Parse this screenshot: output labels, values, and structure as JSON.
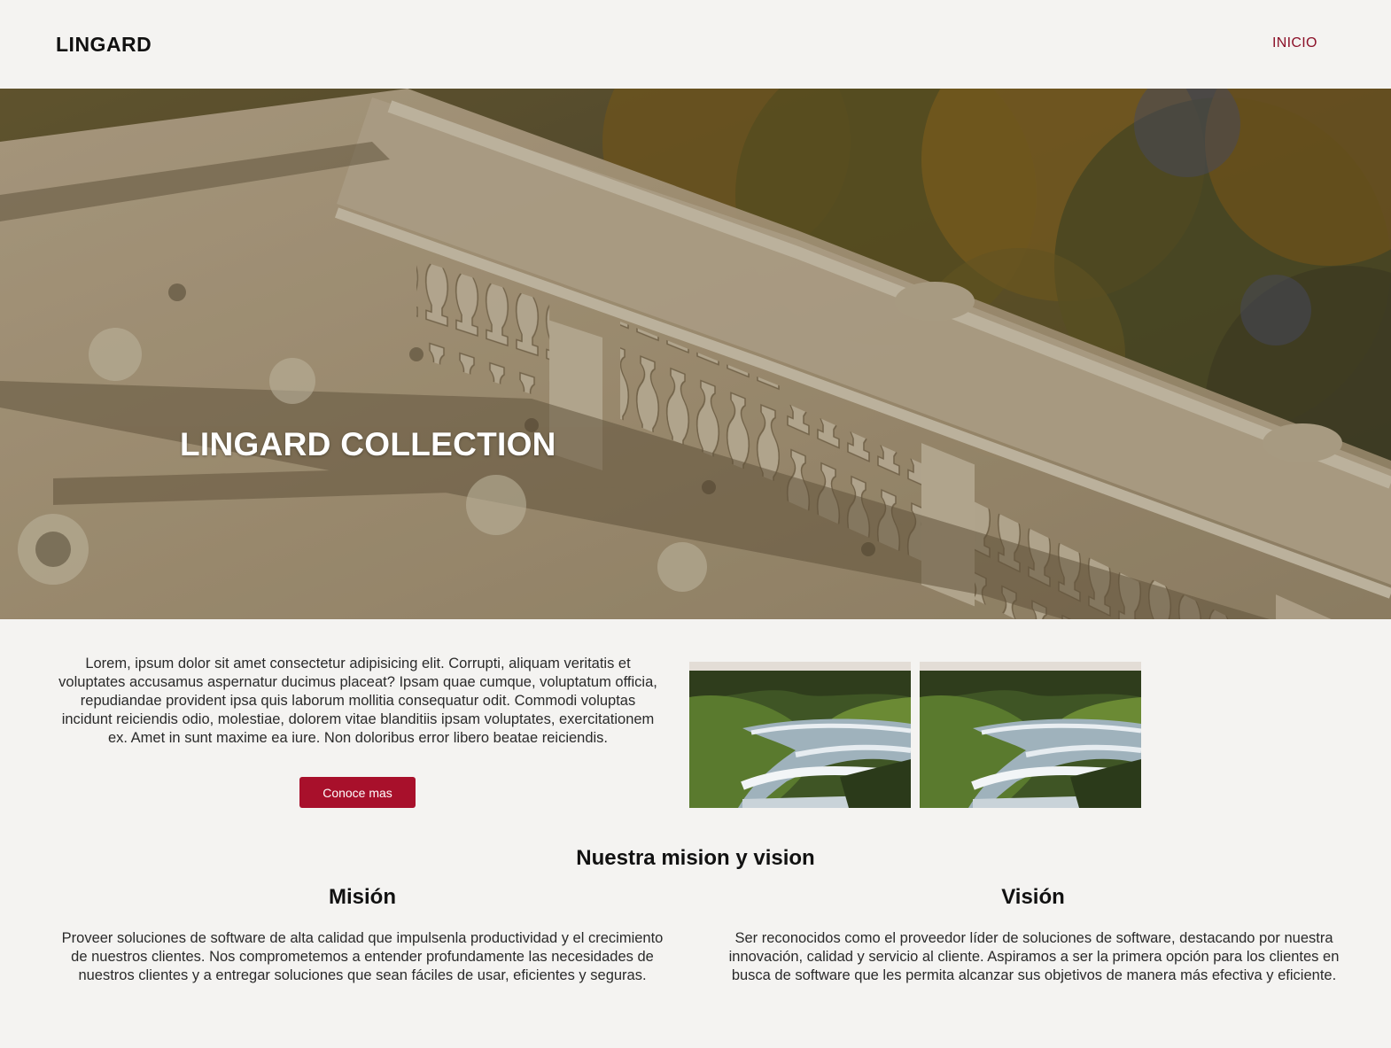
{
  "header": {
    "logo": "LINGARD",
    "nav": [
      {
        "label": "INICIO"
      }
    ]
  },
  "hero": {
    "title": "LINGARD COLLECTION"
  },
  "intro": {
    "text": "Lorem, ipsum dolor sit amet consectetur adipisicing elit. Corrupti, aliquam veritatis et voluptates accusamus aspernatur ducimus placeat? Ipsam quae cumque, voluptatum officia, repudiandae provident ipsa quis laborum mollitia consequatur odit. Commodi voluptas incidunt reiciendis odio, molestiae, dolorem vitae blanditiis ipsam voluptates, exercitationem ex. Amet in sunt maxime ea iure. Non doloribus error libero beatae reiciendis.",
    "button_label": "Conoce mas"
  },
  "mission_vision": {
    "title": "Nuestra mision y vision",
    "mision": {
      "heading": "Misión",
      "text": "Proveer soluciones de software de alta calidad que impulsenla productividad y el crecimiento de nuestros clientes. Nos comprometemos a entender profundamente las necesidades de nuestros clientes y a entregar soluciones que sean fáciles de usar, eficientes y seguras."
    },
    "vision": {
      "heading": "Visión",
      "text": "Ser reconocidos como el proveedor líder de soluciones de software, destacando por nuestra innovación, calidad y servicio al cliente. Aspiramos a ser la primera opción para los clientes en busca de software que les permita alcanzar sus objetivos de manera más efectiva y eficiente."
    }
  },
  "colors": {
    "accent": "#a8102b",
    "nav_link": "#8b1028",
    "background": "#f4f3f1"
  }
}
